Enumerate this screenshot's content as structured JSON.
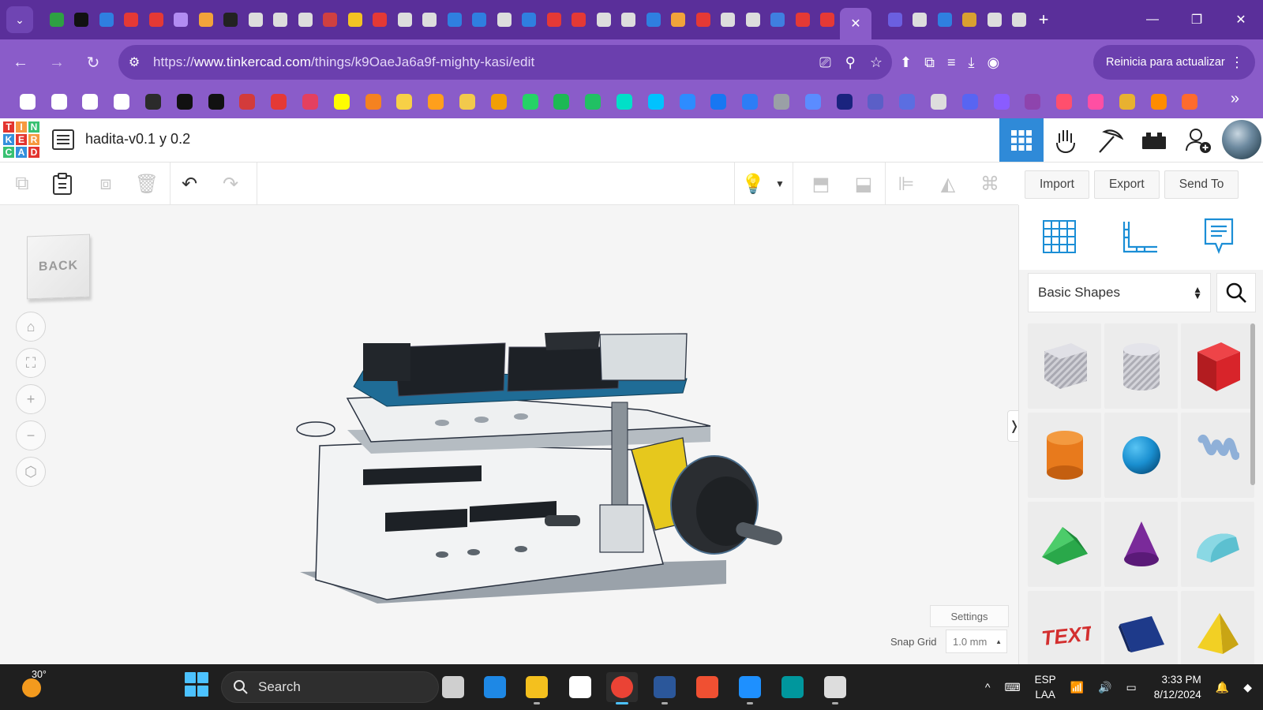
{
  "browser": {
    "active_tab_close": "✕",
    "new_tab": "+",
    "url_prefix": "https://",
    "url_host": "www.tinkercad.com",
    "url_path": "/things/k9OaeJa6a9f-mighty-kasi/edit",
    "update_button": "Reinicia para actualizar",
    "more_bookmarks": "»",
    "favicon_colors": [
      "#2ea043",
      "#111111",
      "#2f7fe0",
      "#e53935",
      "#e53935",
      "#b28cf2",
      "#f2a33a",
      "#222222",
      "#dddddd",
      "#dddddd",
      "#dddddd",
      "#d04040",
      "#f3c323",
      "#e53935",
      "#dddddd",
      "#dddddd",
      "#2f7fe0",
      "#2f7fe0",
      "#dddddd",
      "#2f7fe0",
      "#e53935",
      "#e53935",
      "#dddddd",
      "#dddddd",
      "#2f7fe0",
      "#f2a33a",
      "#e53935",
      "#dddddd",
      "#dddddd",
      "#3f7fe0",
      "#e53935",
      "#e53935"
    ],
    "trailing_favicon_colors": [
      "#6b5fe0",
      "#dddddd",
      "#2f7fe0",
      "#d9a030",
      "#dddddd",
      "#dddddd"
    ],
    "bookmark_colors": [
      "#ffffff",
      "#ffffff",
      "#ffffff",
      "#ffffff",
      "#2b2b2b",
      "#111111",
      "#111111",
      "#d33b3b",
      "#e53935",
      "#e4405f",
      "#fffc00",
      "#f58220",
      "#f7d046",
      "#ff9f1c",
      "#f2c94c",
      "#f29f05",
      "#25d366",
      "#1db954",
      "#21c063",
      "#00e0c8",
      "#00c2ff",
      "#2d8cff",
      "#1877f2",
      "#2d7df6",
      "#9aa0a6",
      "#5b8cff",
      "#1a237e",
      "#5b5fc7",
      "#5b6ee1",
      "#dddddd",
      "#5865f2",
      "#8a5cff",
      "#8e44ad",
      "#ff4f6d",
      "#ff4fa3",
      "#e8b130",
      "#ff8c00",
      "#ff6b2d"
    ]
  },
  "app": {
    "logo_letters": [
      "T",
      "I",
      "N",
      "K",
      "E",
      "R",
      "C",
      "A",
      "D"
    ],
    "logo_colors": [
      "#e3342f",
      "#f6993f",
      "#38c172",
      "#3490dc",
      "#e3342f",
      "#f6993f",
      "#38c172",
      "#3490dc",
      "#e3342f"
    ],
    "design_title": "hadita-v0.1 y 0.2",
    "header_buttons": [
      "3D design view",
      "Circuits",
      "Codeblocks",
      "Bricks",
      "Sim lab",
      "Invite collaborators"
    ],
    "actions": {
      "import": "Import",
      "export": "Export",
      "send_to": "Send To"
    }
  },
  "workplane": {
    "view_cube_label": "BACK",
    "settings_label": "Settings",
    "snap_grid_label": "Snap Grid",
    "snap_grid_value": "1.0 mm",
    "collapse_glyph": "❭"
  },
  "shapes_panel": {
    "category": "Basic Shapes",
    "shapes": [
      {
        "name": "Box (hole)",
        "color": "#b8b8c0"
      },
      {
        "name": "Cylinder (hole)",
        "color": "#c4c4cc"
      },
      {
        "name": "Box",
        "color": "#d8242a"
      },
      {
        "name": "Cylinder",
        "color": "#e87a1c"
      },
      {
        "name": "Sphere",
        "color": "#1a8fd0"
      },
      {
        "name": "Scribble",
        "color": "#8fb0d8"
      },
      {
        "name": "Roof",
        "color": "#2aa84a"
      },
      {
        "name": "Cone",
        "color": "#7a2a9a"
      },
      {
        "name": "Round Roof",
        "color": "#5cc0d0"
      },
      {
        "name": "Text",
        "color": "#d32f2f"
      },
      {
        "name": "Polygon",
        "color": "#1e3a8a"
      },
      {
        "name": "Pyramid",
        "color": "#f2d024"
      }
    ]
  },
  "taskbar": {
    "temperature": "30°",
    "search_placeholder": "Search",
    "language_line1": "ESP",
    "language_line2": "LAA",
    "time": "3:33 PM",
    "date": "8/12/2024",
    "app_colors": [
      "#cfcfcf",
      "#1e88e5",
      "#f4c01e",
      "#ffffff",
      "#ea4335",
      "#2b579a",
      "#f05032",
      "#1e90ff",
      "#00979d",
      "#dddddd"
    ]
  }
}
